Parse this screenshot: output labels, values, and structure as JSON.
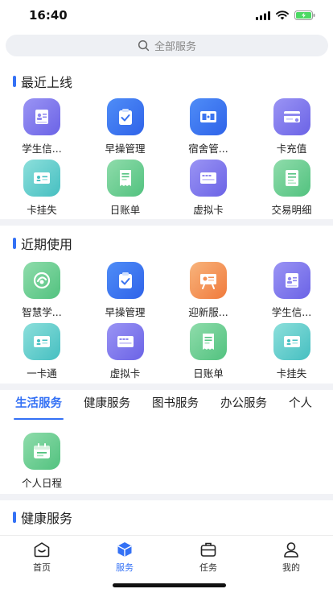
{
  "status": {
    "time": "16:40"
  },
  "search": {
    "placeholder": "全部服务"
  },
  "recent": {
    "title": "最近上线",
    "items": [
      {
        "label": "学生信...",
        "icon": "student-card-icon",
        "color": "purple"
      },
      {
        "label": "早操管理",
        "icon": "clipboard-check-icon",
        "color": "blue"
      },
      {
        "label": "宿舍管...",
        "icon": "dormitory-icon",
        "color": "blue"
      },
      {
        "label": "卡充值",
        "icon": "card-recharge-icon",
        "color": "purple"
      },
      {
        "label": "卡挂失",
        "icon": "id-card-icon",
        "color": "teal"
      },
      {
        "label": "日账单",
        "icon": "bill-icon",
        "color": "green"
      },
      {
        "label": "虚拟卡",
        "icon": "virtual-card-icon",
        "color": "purple"
      },
      {
        "label": "交易明细",
        "icon": "transaction-icon",
        "color": "green"
      }
    ]
  },
  "frequent": {
    "title": "近期使用",
    "items": [
      {
        "label": "智慧学...",
        "icon": "smart-campus-icon",
        "color": "green"
      },
      {
        "label": "早操管理",
        "icon": "clipboard-check-icon",
        "color": "blue"
      },
      {
        "label": "迎新服...",
        "icon": "welcome-board-icon",
        "color": "orange"
      },
      {
        "label": "学生信...",
        "icon": "student-card-icon",
        "color": "purple"
      },
      {
        "label": "一卡通",
        "icon": "id-card-icon",
        "color": "teal"
      },
      {
        "label": "虚拟卡",
        "icon": "virtual-card-icon",
        "color": "purple"
      },
      {
        "label": "日账单",
        "icon": "bill-icon",
        "color": "green"
      },
      {
        "label": "卡挂失",
        "icon": "id-card-icon",
        "color": "teal"
      }
    ]
  },
  "category_tabs": [
    "生活服务",
    "健康服务",
    "图书服务",
    "办公服务",
    "个人"
  ],
  "life_services": [
    {
      "label": "个人日程",
      "icon": "calendar-icon",
      "color": "green"
    }
  ],
  "health": {
    "title": "健康服务"
  },
  "tabbar": [
    {
      "label": "首页",
      "icon": "home-icon"
    },
    {
      "label": "服务",
      "icon": "cube-icon"
    },
    {
      "label": "任务",
      "icon": "briefcase-icon"
    },
    {
      "label": "我的",
      "icon": "person-icon"
    }
  ],
  "colors": {
    "accent": "#3471f5",
    "divider": "#f1f2f6"
  }
}
